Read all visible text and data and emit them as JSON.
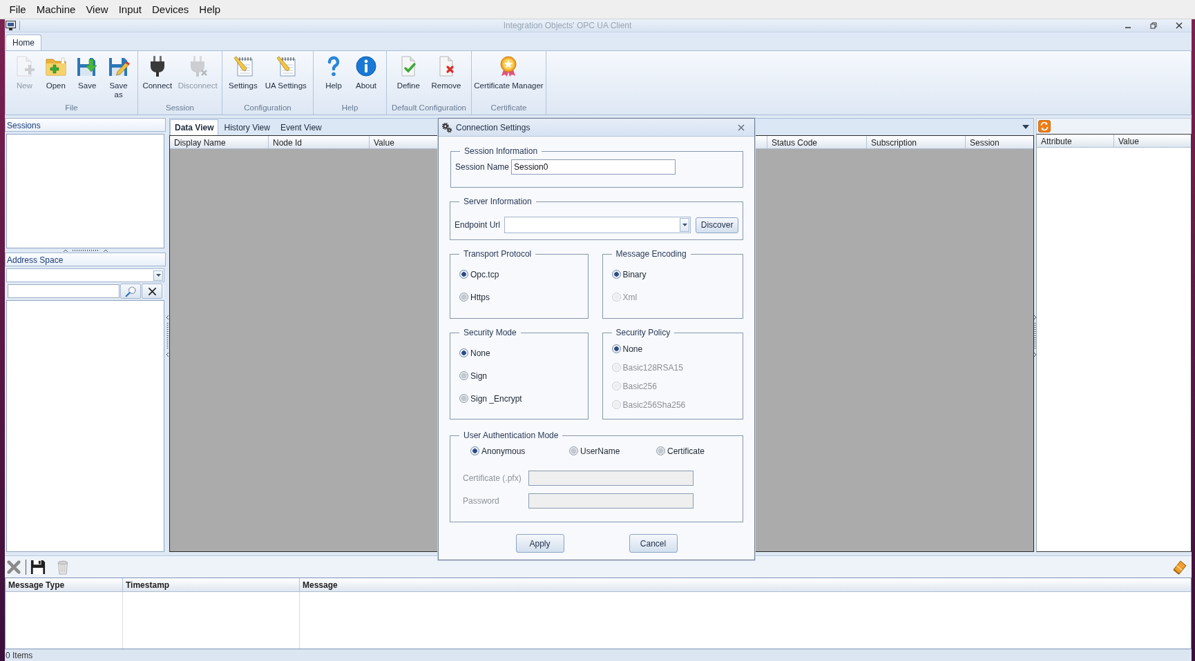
{
  "menu_bar": {
    "items": [
      "File",
      "Machine",
      "View",
      "Input",
      "Devices",
      "Help"
    ]
  },
  "window": {
    "title": "Integration Objects' OPC UA Client"
  },
  "ribbon": {
    "tabs": [
      {
        "label": "Home",
        "selected": true
      }
    ],
    "groups": [
      {
        "label": "File",
        "buttons": [
          {
            "label": "New",
            "kind": "new",
            "disabled": true
          },
          {
            "label": "Open",
            "kind": "open",
            "disabled": false
          },
          {
            "label": "Save",
            "kind": "save",
            "disabled": false
          },
          {
            "label": "Save as",
            "kind": "saveas",
            "disabled": false
          }
        ]
      },
      {
        "label": "Session",
        "buttons": [
          {
            "label": "Connect",
            "kind": "connect",
            "disabled": false
          },
          {
            "label": "Disconnect",
            "kind": "disconnect",
            "disabled": true
          }
        ]
      },
      {
        "label": "Configuration",
        "buttons": [
          {
            "label": "Settings",
            "kind": "settings",
            "disabled": false
          },
          {
            "label": "UA Settings",
            "kind": "settings",
            "disabled": false
          }
        ]
      },
      {
        "label": "Help",
        "buttons": [
          {
            "label": "Help",
            "kind": "help",
            "disabled": false
          },
          {
            "label": "About",
            "kind": "about",
            "disabled": false
          }
        ]
      },
      {
        "label": "Default Configuration",
        "buttons": [
          {
            "label": "Define",
            "kind": "define",
            "disabled": false
          },
          {
            "label": "Remove",
            "kind": "remove",
            "disabled": false
          }
        ]
      },
      {
        "label": "Certificate",
        "buttons": [
          {
            "label": "Certificate Manager",
            "kind": "certificate",
            "disabled": false
          }
        ]
      }
    ]
  },
  "sessions_panel": {
    "title": "Sessions"
  },
  "address_space_panel": {
    "title": "Address Space"
  },
  "data_tabs": [
    {
      "label": "Data View",
      "selected": true
    },
    {
      "label": "History View",
      "selected": false
    },
    {
      "label": "Event View",
      "selected": false
    }
  ],
  "data_table": {
    "columns": [
      "Display Name",
      "Node Id",
      "Value",
      "Status Code",
      "Subscription",
      "Session"
    ]
  },
  "attributes_table": {
    "columns": [
      "Attribute",
      "Value"
    ]
  },
  "log_table": {
    "columns": [
      "Message Type",
      "Timestamp",
      "Message"
    ]
  },
  "status_bar": {
    "text": "0 Items"
  },
  "dialog": {
    "title": "Connection Settings",
    "session_information": {
      "title": "Session Information",
      "label": "Session Name",
      "value": "Session0"
    },
    "server_information": {
      "title": "Server Information",
      "label": "Endpoint Url",
      "button": "Discover"
    },
    "transport_protocol": {
      "title": "Transport Protocol",
      "options": [
        {
          "label": "Opc.tcp",
          "selected": true,
          "disabled": false
        },
        {
          "label": "Https",
          "selected": false,
          "disabled": false
        }
      ]
    },
    "message_encoding": {
      "title": "Message Encoding",
      "options": [
        {
          "label": "Binary",
          "selected": true,
          "disabled": false
        },
        {
          "label": "Xml",
          "selected": false,
          "disabled": true
        }
      ]
    },
    "security_mode": {
      "title": "Security Mode",
      "options": [
        {
          "label": "None",
          "selected": true,
          "disabled": false
        },
        {
          "label": "Sign",
          "selected": false,
          "disabled": false
        },
        {
          "label": "Sign _Encrypt",
          "selected": false,
          "disabled": false
        }
      ]
    },
    "security_policy": {
      "title": "Security Policy",
      "options": [
        {
          "label": "None",
          "selected": true,
          "disabled": false
        },
        {
          "label": "Basic128RSA15",
          "selected": false,
          "disabled": true
        },
        {
          "label": "Basic256",
          "selected": false,
          "disabled": true
        },
        {
          "label": "Basic256Sha256",
          "selected": false,
          "disabled": true
        }
      ]
    },
    "user_authentication_mode": {
      "title": "User Authentication Mode",
      "options": [
        {
          "label": "Anonymous",
          "selected": true,
          "disabled": false
        },
        {
          "label": "UserName",
          "selected": false,
          "disabled": false
        },
        {
          "label": "Certificate",
          "selected": false,
          "disabled": false
        }
      ],
      "fields": [
        {
          "label": "Certificate (.pfx)",
          "disabled": true
        },
        {
          "label": "Password",
          "disabled": true
        }
      ]
    },
    "buttons": [
      "Apply",
      "Cancel"
    ]
  }
}
